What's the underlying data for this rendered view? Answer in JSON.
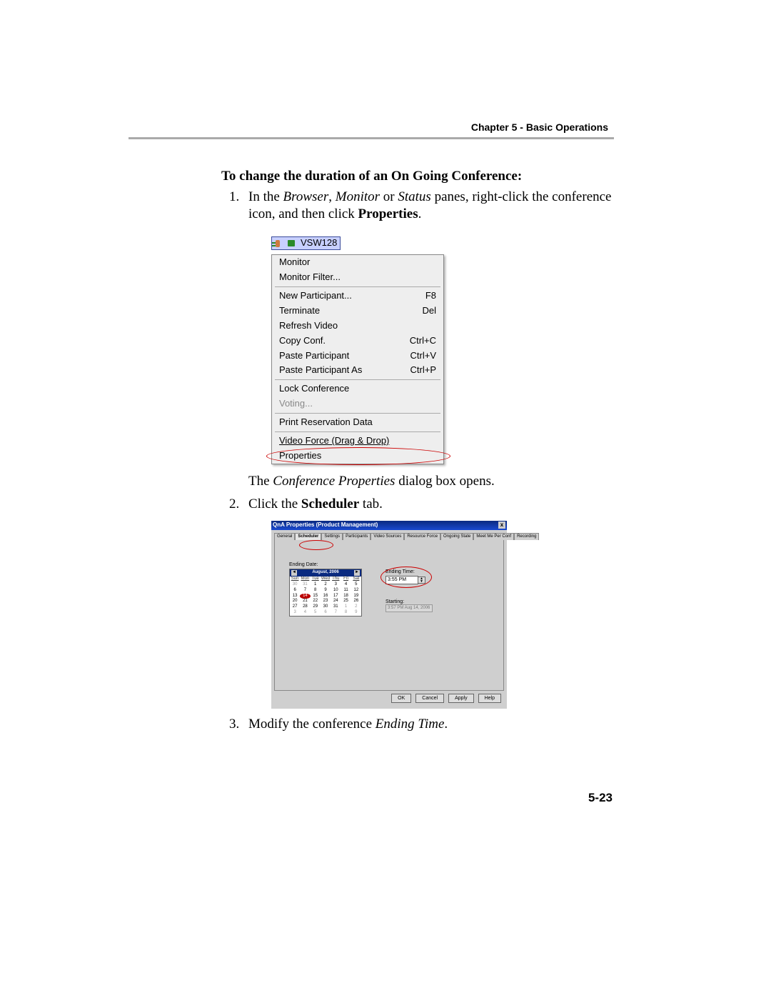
{
  "header": {
    "chapter": "Chapter 5 - Basic Operations"
  },
  "heading": "To change the duration of an On Going Conference:",
  "step1": {
    "pre": "In the ",
    "em1": "Browser",
    "sep1": ", ",
    "em2": "Monitor",
    "sep2": " or ",
    "em3": "Status",
    "post1": " panes, right-click the conference icon, and then click ",
    "bold": "Properties",
    "post2": "."
  },
  "after1": {
    "pre": "The ",
    "em": "Conference Properties",
    "post": " dialog box opens."
  },
  "step2": {
    "pre": "Click the ",
    "bold": "Scheduler",
    "post": " tab."
  },
  "step3": {
    "pre": "Modify the conference ",
    "em": "Ending Time",
    "post": "."
  },
  "context_menu": {
    "node_label": "VSW128",
    "items": [
      {
        "label": "Monitor",
        "shortcut": "",
        "disabled": false
      },
      {
        "label": "Monitor Filter...",
        "shortcut": "",
        "disabled": false
      }
    ],
    "items2": [
      {
        "label": "New Participant...",
        "shortcut": "F8",
        "disabled": false
      },
      {
        "label": "Terminate",
        "shortcut": "Del",
        "disabled": false
      },
      {
        "label": "Refresh Video",
        "shortcut": "",
        "disabled": false
      },
      {
        "label": "Copy Conf.",
        "shortcut": "Ctrl+C",
        "disabled": false
      },
      {
        "label": "Paste Participant",
        "shortcut": "Ctrl+V",
        "disabled": false
      },
      {
        "label": "Paste Participant As",
        "shortcut": "Ctrl+P",
        "disabled": false
      }
    ],
    "items3": [
      {
        "label": "Lock Conference",
        "shortcut": "",
        "disabled": false
      },
      {
        "label": "Voting...",
        "shortcut": "",
        "disabled": true
      }
    ],
    "items4": [
      {
        "label": "Print Reservation Data",
        "shortcut": "",
        "disabled": false
      }
    ],
    "items5": [
      {
        "label": "Video Force (Drag & Drop)",
        "shortcut": "",
        "disabled": false,
        "underline": true
      },
      {
        "label": "Properties",
        "shortcut": "",
        "disabled": false,
        "circled": true
      }
    ]
  },
  "dialog": {
    "title": "QnA Properties (Product Management)",
    "tabs": [
      "General",
      "Scheduler",
      "Settings",
      "Participants",
      "Video Sources",
      "Resource Force",
      "Ongoing State",
      "Meet Me Per Conf",
      "Recording"
    ],
    "active_tab": 1,
    "ending_date_label": "Ending Date:",
    "calendar": {
      "month": "August, 2006",
      "dow": [
        "Sun",
        "Mon",
        "Tue",
        "Wed",
        "Thu",
        "Fri",
        "Sat"
      ],
      "rows": [
        [
          "30",
          "31",
          "1",
          "2",
          "3",
          "4",
          "5"
        ],
        [
          "6",
          "7",
          "8",
          "9",
          "10",
          "11",
          "12"
        ],
        [
          "13",
          "14",
          "15",
          "16",
          "17",
          "18",
          "19"
        ],
        [
          "20",
          "21",
          "22",
          "23",
          "24",
          "25",
          "26"
        ],
        [
          "27",
          "28",
          "29",
          "30",
          "31",
          "1",
          "2"
        ],
        [
          "3",
          "4",
          "5",
          "6",
          "7",
          "8",
          "9"
        ]
      ],
      "dim_first": 2,
      "dim_last_start": 31,
      "today": "14"
    },
    "ending_time_label": "Ending Time:",
    "ending_time_value": "3:55 PM",
    "starting_label": "Starting:",
    "starting_value": "3:57 PM Aug 14, 2006",
    "buttons": [
      "OK",
      "Cancel",
      "Apply",
      "Help"
    ]
  },
  "page_number": "5-23"
}
